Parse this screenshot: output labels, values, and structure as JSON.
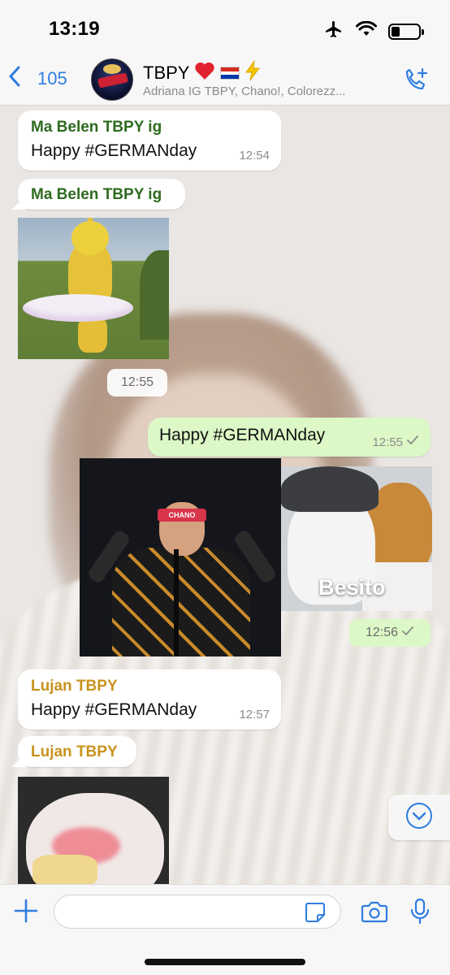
{
  "status_bar": {
    "time": "13:19",
    "icons": [
      "airplane-icon",
      "wifi-icon",
      "battery-icon"
    ]
  },
  "header": {
    "back_count": "105",
    "title": "TBPY",
    "title_emojis": [
      "heart-icon",
      "paraguay-flag-icon",
      "lightning-icon"
    ],
    "subtitle": "Adriana IG TBPY, Chano!, Colorezz...",
    "accent_color": "#2f7de1"
  },
  "messages": [
    {
      "sender": "Ma Belen TBPY ig",
      "text": "Happy #GERMANday",
      "time": "12:54"
    },
    {
      "sender": "Ma Belen TBPY ig"
    },
    {
      "time": "12:55"
    },
    {
      "text": "Happy #GERMANday",
      "time": "12:55"
    },
    {
      "sticker_text": "Besito",
      "time": "12:56"
    },
    {
      "sender": "Lujan TBPY",
      "text": "Happy #GERMANday",
      "time": "12:57"
    },
    {
      "sender": "Lujan TBPY"
    }
  ],
  "colors": {
    "incoming_bubble": "#ffffff",
    "outgoing_bubble": "#dcf8c6",
    "sender_green": "#2e6b1f",
    "sender_gold": "#c7931d"
  },
  "composer": {
    "placeholder": ""
  }
}
